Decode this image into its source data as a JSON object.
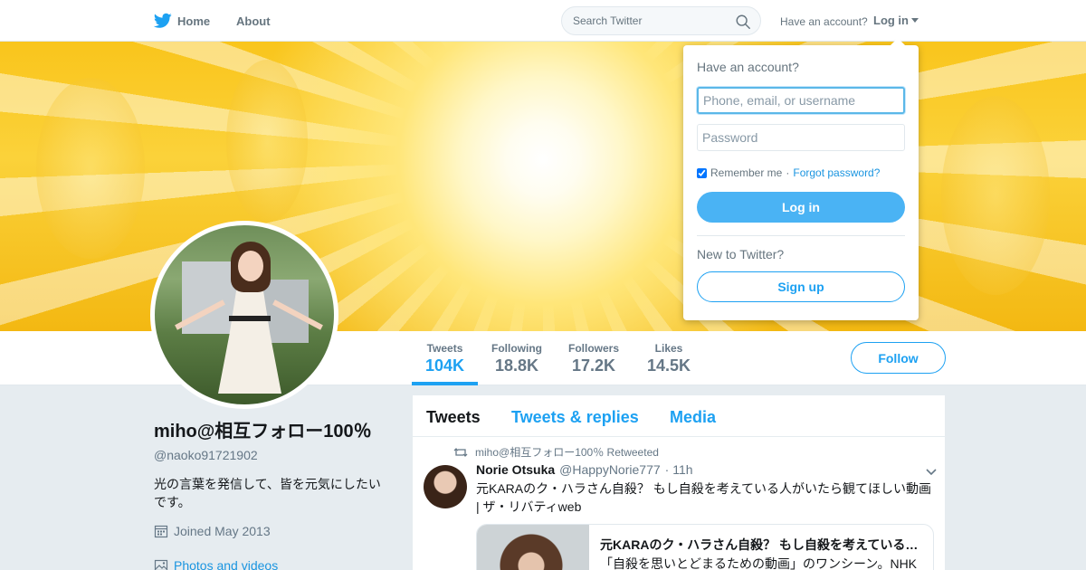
{
  "nav": {
    "home_label": "Home",
    "about_label": "About",
    "search_placeholder": "Search Twitter",
    "have_account": "Have an account?",
    "login_label": "Log in",
    "brand_color": "#1da1f2"
  },
  "profile": {
    "display_name": "miho@相互フォロー100％",
    "username": "@naoko91721902",
    "bio": "光の言葉を発信して、皆を元気にしたいです。",
    "joined": "Joined May 2013",
    "photos_link": "Photos and videos",
    "follow_label": "Follow",
    "stats": [
      {
        "label": "Tweets",
        "value": "104K"
      },
      {
        "label": "Following",
        "value": "18.8K"
      },
      {
        "label": "Followers",
        "value": "17.2K"
      },
      {
        "label": "Likes",
        "value": "14.5K"
      }
    ]
  },
  "timeline": {
    "tabs": [
      {
        "label": "Tweets"
      },
      {
        "label": "Tweets & replies"
      },
      {
        "label": "Media"
      }
    ],
    "tweet": {
      "retweet_note": "miho@相互フォロー100％ Retweeted",
      "name": "Norie Otsuka",
      "handle": "@HappyNorie777",
      "time": "· 11h",
      "text": "元KARAのク・ハラさん自殺？ もし自殺を考えている人がいたら観てほしい動画 | ザ・リバティweb",
      "card_title": "元KARAのク・ハラさん自殺？ もし自殺を考えている人が...",
      "card_desc": "「自殺を思いとどまるための動画」のワンシーン。NHK"
    }
  },
  "login_dropdown": {
    "title": "Have an account?",
    "username_placeholder": "Phone, email, or username",
    "password_placeholder": "Password",
    "remember_label": "Remember me",
    "separator": "·",
    "forgot_label": "Forgot password?",
    "login_button": "Log in",
    "new_label": "New to Twitter?",
    "signup_button": "Sign up"
  }
}
